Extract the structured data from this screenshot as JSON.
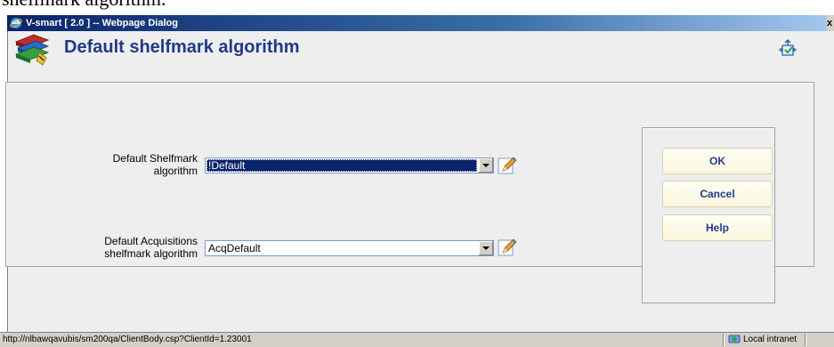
{
  "doc_caption": "shelfmark algorithm.",
  "window": {
    "title": "V-smart [ 2.0 ] -- Webpage Dialog",
    "close_label": "x"
  },
  "header": {
    "title": "Default shelfmark algorithm"
  },
  "fields": [
    {
      "label_line1": "Default Shelfmark",
      "label_line2": "algorithm",
      "value": "!Default"
    },
    {
      "label_line1": "Default Acquisitions",
      "label_line2": "shelfmark algorithm",
      "value": "AcqDefault"
    }
  ],
  "buttons": {
    "ok": "OK",
    "cancel": "Cancel",
    "help": "Help"
  },
  "status": {
    "url": "http://nlbawqavubis/sm200qa/ClientBody.csp?ClientId=1.23001",
    "zone": "Local intranet"
  },
  "colors": {
    "title_blue": "#1f3a8a",
    "titlebar_dark": "#0a246a",
    "selection": "#0a246a",
    "button_bg": "#fbf6dd"
  },
  "icons": {
    "header": "books-stack-icon",
    "sync": "sync-arrows-icon",
    "edit": "pencil-icon",
    "window": "ie-icon",
    "zone": "intranet-icon"
  }
}
